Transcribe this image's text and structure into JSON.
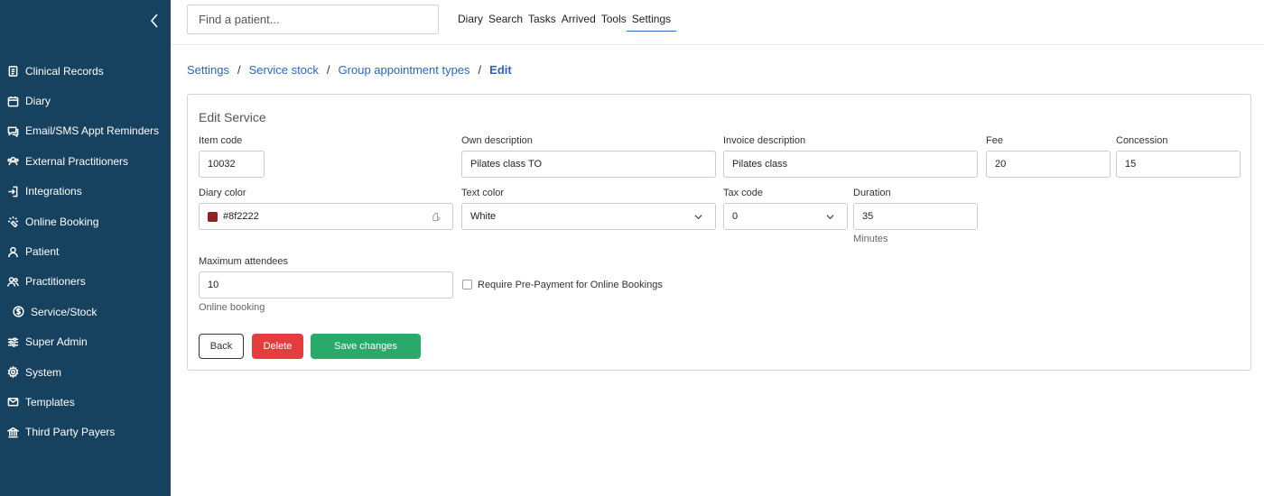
{
  "sidebar": {
    "items": [
      {
        "label": "Clinical Records",
        "icon": "clipboard-icon"
      },
      {
        "label": "Diary",
        "icon": "calendar-icon"
      },
      {
        "label": "Email/SMS Appt Reminders",
        "icon": "chat-icon"
      },
      {
        "label": "External Practitioners",
        "icon": "users-external-icon"
      },
      {
        "label": "Integrations",
        "icon": "login-icon"
      },
      {
        "label": "Online Booking",
        "icon": "sparkle-icon"
      },
      {
        "label": "Patient",
        "icon": "person-icon"
      },
      {
        "label": "Practitioners",
        "icon": "people-icon"
      },
      {
        "label": "Service/Stock",
        "icon": "dollar-circle-icon"
      },
      {
        "label": "Super Admin",
        "icon": "sliders-icon"
      },
      {
        "label": "System",
        "icon": "gear-icon"
      },
      {
        "label": "Templates",
        "icon": "mail-icon"
      },
      {
        "label": "Third Party Payers",
        "icon": "bank-icon"
      }
    ]
  },
  "topbar": {
    "search_placeholder": "Find a patient...",
    "nav": [
      "Diary",
      "Search",
      "Tasks",
      "Arrived",
      "Tools",
      "Settings"
    ],
    "active_nav": "Settings"
  },
  "breadcrumb": {
    "items": [
      "Settings",
      "Service stock",
      "Group appointment types"
    ],
    "current": "Edit"
  },
  "form": {
    "title": "Edit Service",
    "item_code": {
      "label": "Item code",
      "value": "10032"
    },
    "own_description": {
      "label": "Own description",
      "value": "Pilates class TO"
    },
    "invoice_description": {
      "label": "Invoice description",
      "value": "Pilates class"
    },
    "fee": {
      "label": "Fee",
      "value": "20"
    },
    "concession": {
      "label": "Concession",
      "value": "15"
    },
    "diary_color": {
      "label": "Diary color",
      "value": "#8f2222"
    },
    "text_color": {
      "label": "Text color",
      "value": "White"
    },
    "tax_code": {
      "label": "Tax code",
      "value": "0"
    },
    "duration": {
      "label": "Duration",
      "value": "35",
      "helper": "Minutes"
    },
    "max_attendees": {
      "label": "Maximum attendees",
      "value": "10",
      "helper": "Online booking"
    },
    "prepayment": {
      "label": "Require Pre-Payment for Online Bookings",
      "checked": false
    }
  },
  "buttons": {
    "back": "Back",
    "delete": "Delete",
    "save": "Save changes"
  },
  "colors": {
    "sidebar_bg": "#16415f",
    "link": "#2d63c8",
    "delete": "#e53d3d",
    "save": "#2aaa6a",
    "diary_swatch": "#8f2222"
  }
}
